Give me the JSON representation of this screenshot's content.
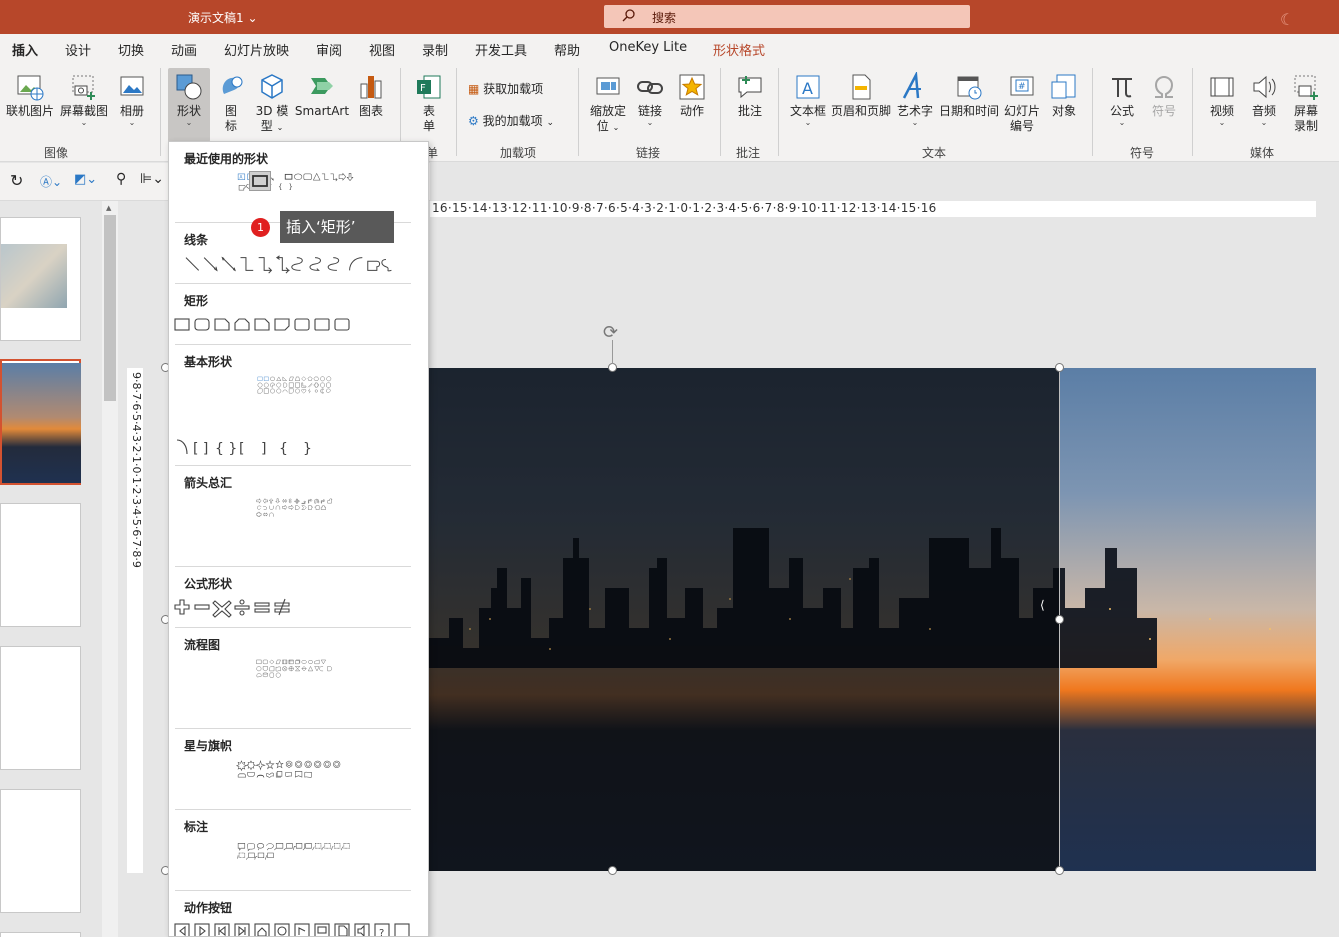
{
  "window": {
    "title": "演示文稿1",
    "search_label": "搜索"
  },
  "tabs": [
    {
      "label": "插入",
      "active": true
    },
    {
      "label": "设计"
    },
    {
      "label": "切换"
    },
    {
      "label": "动画"
    },
    {
      "label": "幻灯片放映"
    },
    {
      "label": "审阅"
    },
    {
      "label": "视图"
    },
    {
      "label": "录制"
    },
    {
      "label": "开发工具"
    },
    {
      "label": "帮助"
    },
    {
      "label": "OneKey Lite"
    },
    {
      "label": "形状格式",
      "contextual": true
    }
  ],
  "ribbon": {
    "buttons": {
      "online_pic": "联机图片",
      "screenshot": "屏幕截图",
      "album": "相册",
      "shapes": "形状",
      "icons_1": "图",
      "icons_2": "标",
      "model_1": "3D 模",
      "model_2": "型",
      "smartart": "SmartArt",
      "chart": "图表",
      "form_1": "表",
      "form_2": "单",
      "get_addins": "获取加载项",
      "my_addins": "我的加载项",
      "zoom_1": "缩放定",
      "zoom_2": "位",
      "link": "链接",
      "action": "动作",
      "comment": "批注",
      "textbox": "文本框",
      "header_footer": "页眉和页脚",
      "wordart": "艺术字",
      "datetime": "日期和时间",
      "slide_num_1": "幻灯片",
      "slide_num_2": "编号",
      "object": "对象",
      "equation": "公式",
      "symbol": "符号",
      "video": "视频",
      "audio": "音频",
      "screen_rec_1": "屏幕",
      "screen_rec_2": "录制"
    },
    "groups": {
      "images": "图像",
      "form": "单",
      "addins": "加载项",
      "links": "链接",
      "comments": "批注",
      "text": "文本",
      "symbols": "符号",
      "media": "媒体"
    }
  },
  "shapes_menu": {
    "sections": {
      "recent": "最近使用的形状",
      "lines": "线条",
      "rect": "矩形",
      "basic": "基本形状",
      "arrows": "箭头总汇",
      "equation": "公式形状",
      "flowchart": "流程图",
      "stars": "星与旗帜",
      "callouts": "标注",
      "action": "动作按钮"
    },
    "tooltip": "插入‘矩形’",
    "badge": "1"
  },
  "ruler": {
    "h_ticks": "16·15·14·13·12·11·10·9·8·7·6·5·4·3·2·1·0·1·2·3·4·5·6·7·8·9·10·11·12·13·14·15·16",
    "v_ticks": "9·8·7·6·5·4·3·2·1·0·1·2·3·4·5·6·7·8·9"
  },
  "colors": {
    "accent": "#b7472a",
    "ribbon_bg": "#f3f2f1",
    "badge": "#e02020"
  }
}
